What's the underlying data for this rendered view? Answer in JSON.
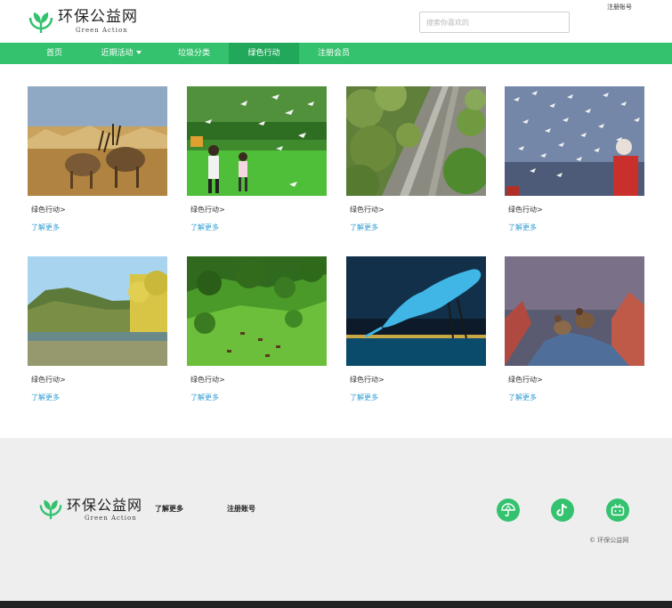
{
  "header": {
    "logo_title": "环保公益网",
    "logo_sub": "Green Action",
    "search_placeholder": "搜索你喜欢的",
    "register_label": "注册账号"
  },
  "nav": {
    "items": [
      {
        "label": "首页"
      },
      {
        "label": "近期活动"
      },
      {
        "label": "垃圾分类"
      },
      {
        "label": "绿色行动"
      },
      {
        "label": "注册会员"
      }
    ],
    "active_index": 3
  },
  "cards": [
    {
      "title": "绿色行动>",
      "more": "了解更多",
      "image": "antelopes-grassland"
    },
    {
      "title": "绿色行动>",
      "more": "了解更多",
      "image": "children-birds-park"
    },
    {
      "title": "绿色行动>",
      "more": "了解更多",
      "image": "forest-road-aerial"
    },
    {
      "title": "绿色行动>",
      "more": "了解更多",
      "image": "seagull-flock"
    },
    {
      "title": "绿色行动>",
      "more": "了解更多",
      "image": "autumn-lake"
    },
    {
      "title": "绿色行动>",
      "more": "了解更多",
      "image": "green-hills-cattle"
    },
    {
      "title": "绿色行动>",
      "more": "了解更多",
      "image": "blue-heron-water"
    },
    {
      "title": "绿色行动>",
      "more": "了解更多",
      "image": "quails-on-rock"
    }
  ],
  "footer": {
    "logo_title": "环保公益网",
    "logo_sub": "Green Action",
    "link_more": "了解更多",
    "link_register": "注册账号",
    "social": [
      "umbrella-icon",
      "tiktok-icon",
      "bilibili-icon"
    ],
    "copyright": "© 环保公益网"
  },
  "colors": {
    "brand_green": "#34c26e",
    "nav_active": "#22a85b",
    "link_blue": "#2f9bd1",
    "footer_bg": "#eeeeee"
  }
}
